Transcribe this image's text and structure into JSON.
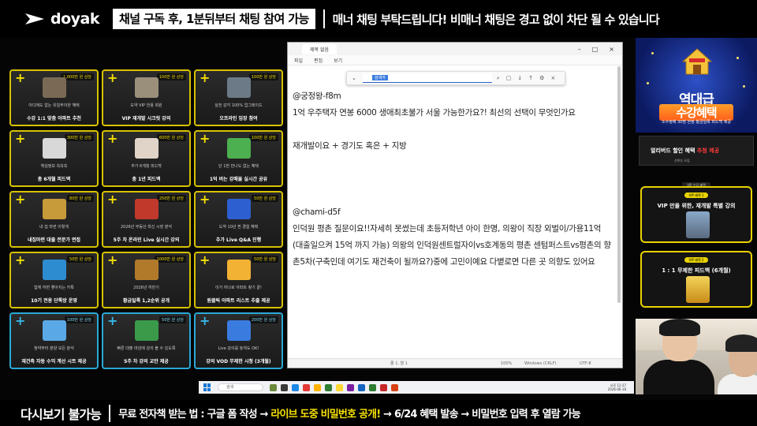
{
  "topbar": {
    "logo_text": "doyak",
    "notice_box": "채널 구독 후, 1분뒤부터 채팅 참여 가능",
    "notice_text": "매너 채팅 부탁드립니다! 비매너 채팅은 경고 없이 차단 될 수 있습니다"
  },
  "cards": [
    {
      "plus": "+",
      "badge": "1,000만 원 상당",
      "cap": "아디에도 없는 유일무이한 혜택",
      "title": "수강 1:1 맞춤 아파트 추천",
      "color": "gold"
    },
    {
      "plus": "+",
      "badge": "100만 원 상당",
      "cap": "도약 VIP 전용 회원",
      "title": "VIP 재개발 시크릿 강의",
      "color": "gold"
    },
    {
      "plus": "+",
      "badge": "100만 원 상당",
      "cap": "실전 감각 100% 업그레이드",
      "title": "오프라인 임장 참여",
      "color": "gold"
    },
    {
      "plus": "+",
      "badge": "300만 원 상당",
      "cap": "핵심정보 쏙쏙쏙",
      "title": "총 6개월 피드백",
      "color": "gold"
    },
    {
      "plus": "+",
      "badge": "600만 원 상당",
      "cap": "추가 6개월 피드백",
      "title": "총 1년 피드백",
      "color": "gold"
    },
    {
      "plus": "+",
      "badge": "100만 원 상당",
      "cap": "단 1번 만나도 없는 혜택",
      "title": "1억 버는 강매물 실시간 공유",
      "color": "gold"
    },
    {
      "plus": "+",
      "badge": "80만 원 상당",
      "cap": "내 집 마련 이렇게",
      "title": "내집마련 대출 전문가 면접",
      "color": "gold"
    },
    {
      "plus": "+",
      "badge": "250만 원 상당",
      "cap": "2026년 부동산 최신 시장 분석",
      "title": "5주 차 온라인 Live 실시간 강의",
      "color": "gold"
    },
    {
      "plus": "+",
      "badge": "50만 원 상당",
      "cap": "도약 10년 찐 경험 혜택",
      "title": "추가 Live Q&A 진행",
      "color": "gold"
    },
    {
      "plus": "+",
      "badge": "50만 원 상당",
      "cap": "함께 하면 좋아지는 카톡",
      "title": "10기 전용 단톡방 운영",
      "color": "gold"
    },
    {
      "plus": "+",
      "badge": "1000만 원 상당",
      "cap": "2026년 하반기",
      "title": "황금일록 1,2순위 공개",
      "color": "gold"
    },
    {
      "plus": "+",
      "badge": "50만 원 상당",
      "cap": "이거 하나로 아파트 찾기 끝!",
      "title": "원클릭 아파트 리스트 추출 제공",
      "color": "gold"
    },
    {
      "plus": "+",
      "badge": "100만 원 상당",
      "cap": "청약부터 분양 모든 분석",
      "title": "재건축 자동 수익 계산 시트 제공",
      "color": "blue"
    },
    {
      "plus": "+",
      "badge": "50만 원 상당",
      "cap": "빠른 대출 마감에 강의 볼 수 있도록",
      "title": "5주 차 강의 교안 제공",
      "color": "blue"
    },
    {
      "plus": "+",
      "badge": "200만 원 상당",
      "cap": "Live 강의를 놓쳐도 OK!",
      "title": "강의 VOD 무제한 시청 (3개월)",
      "color": "blue"
    }
  ],
  "notepad": {
    "tab": "제목 없음",
    "menu": [
      "파일",
      "편집",
      "보기"
    ],
    "find_selected": "검색어",
    "lines": [
      "@궁정왕-f8m",
      "1억 우주택자 연봉 6000 생애최초불가 서울 가능한가요?! 최선의 선택이 무엇인가요",
      "",
      "재개발이요 + 경기도 혹은 + 지방",
      "",
      "",
      "",
      "@chami-d5f",
      "인덕원 평촌 질문이요!!자세히 못썼는데 초등저학년 아이 한명, 의왕이 직장 외벌이/가용11억(대출일으켜 15억 까지 가능) 의왕의 인덕원센트럴자이vs호계동의 평촌 센텀퍼스트vs평촌의 향촌5차(구축인데 여기도 재건축이 될까요?)중에 고민이예요 다볕로면 다른 곳 의향도 있어요"
    ],
    "status": {
      "pos": "줄 1, 열 1",
      "zoom": "100%",
      "eol": "Windows (CRLF)",
      "enc": "UTF-8"
    }
  },
  "promo": {
    "big": "역대급",
    "big2": "수강혜택",
    "small": "소수정예 30명 한정 황금일록 피드백 제공"
  },
  "early": {
    "text_a": "얼리버드 할인 혜택",
    "text_b": "추첨 제공",
    "tag": "선착순 모집"
  },
  "vip": {
    "head": "VIP 수강 혜택",
    "items": [
      {
        "pill": "VIP 혜택 1",
        "title": "VIP 만을 위한, 재개발 특별 강의"
      },
      {
        "pill": "VIP 혜택 2",
        "title": "1 : 1 무제한 피드백 (6개월)"
      }
    ]
  },
  "taskbar": {
    "search": "검색",
    "time": "오후 12:37",
    "date": "2026-06-18"
  },
  "bottombar": {
    "left": "다시보기 불가능",
    "text_a": "무료 전자책 받는 법 : 구글 폼 작성 → ",
    "text_hl": "라이브 도중 비밀번호 공개!",
    "text_b": " → 6/24 혜택 발송 → 비밀번호 입력 후 열람 가능"
  },
  "colors": {
    "accent_gold": "#f2dd00",
    "accent_blue": "#2aa9d8",
    "highlight": "#f5e100"
  }
}
